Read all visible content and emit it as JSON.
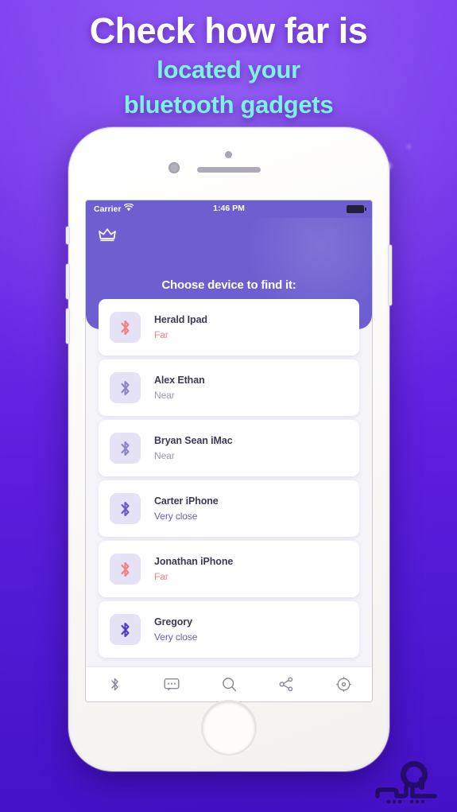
{
  "promo": {
    "headline_line1": "Check how far is",
    "headline_line2": "located your",
    "headline_line3": "bluetooth gadgets",
    "headline_color": "#ffffff",
    "subhead_color": "#7ef2e4",
    "background_top_color": "#7d3ff0",
    "background_bottom_color": "#4311c6"
  },
  "status_bar": {
    "carrier": "Carrier",
    "wifi_icon": "wifi-icon",
    "time": "1:46 PM",
    "battery_icon": "battery-full-icon"
  },
  "app": {
    "header": {
      "crown_icon": "crown-icon",
      "title": "Choose device to find it:",
      "background_color": "#6d5fd0"
    },
    "devices": [
      {
        "name": "Herald Ipad",
        "status": "Far",
        "status_class": "st-far",
        "icon": "bluetooth-icon",
        "icon_color": "#f4807f"
      },
      {
        "name": "Alex Ethan",
        "status": "Near",
        "status_class": "st-near",
        "icon": "bluetooth-icon",
        "icon_color": "#8c86c9"
      },
      {
        "name": "Bryan Sean iMac",
        "status": "Near",
        "status_class": "st-near",
        "icon": "bluetooth-icon",
        "icon_color": "#8c86c9"
      },
      {
        "name": "Carter iPhone",
        "status": "Very close",
        "status_class": "st-very",
        "icon": "bluetooth-icon",
        "icon_color": "#6a5acd"
      },
      {
        "name": "Jonathan iPhone",
        "status": "Far",
        "status_class": "st-far",
        "icon": "bluetooth-icon",
        "icon_color": "#f4807f"
      },
      {
        "name": "Gregory",
        "status": "Very close",
        "status_class": "st-very",
        "icon": "bluetooth-icon",
        "icon_color": "#4f3fc4"
      }
    ],
    "tabbar": [
      {
        "icon": "bluetooth-icon"
      },
      {
        "icon": "chat-bubble-icon"
      },
      {
        "icon": "search-icon"
      },
      {
        "icon": "share-icon"
      },
      {
        "icon": "radar-icon"
      }
    ]
  },
  "watermark": {
    "icon": "sarzamin-logo"
  }
}
